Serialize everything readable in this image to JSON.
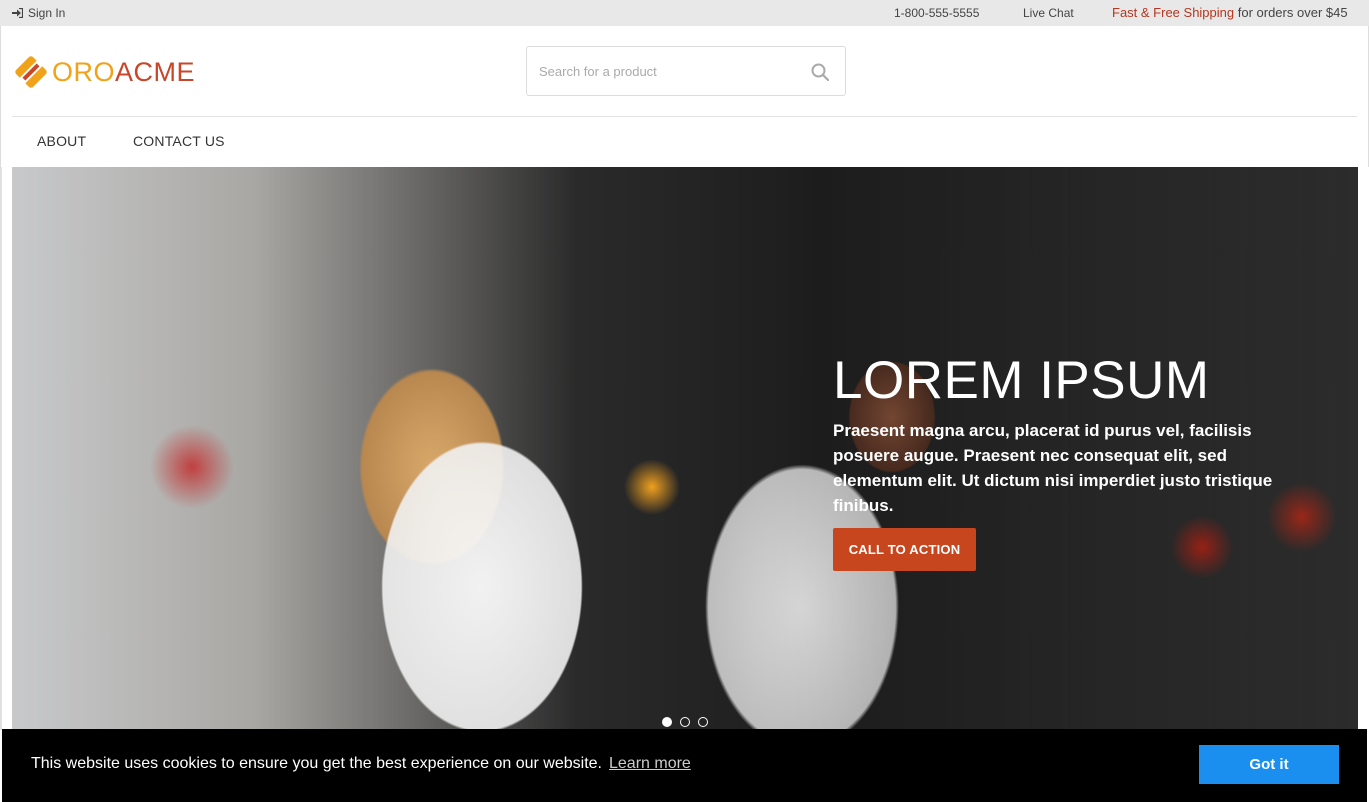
{
  "topbar": {
    "signin_label": "Sign In",
    "phone": "1-800-555-5555",
    "live_chat": "Live Chat",
    "shipping_accent": "Fast & Free Shipping",
    "shipping_rest": " for orders over $45"
  },
  "header": {
    "logo_part1": "ORO",
    "logo_part2": "ACME",
    "search_placeholder": "Search for a product"
  },
  "nav": {
    "items": [
      {
        "label": "ABOUT"
      },
      {
        "label": "CONTACT US"
      }
    ]
  },
  "hero": {
    "title": "LOREM IPSUM",
    "text": "Praesent magna arcu, placerat id purus vel, facilisis posuere augue. Praesent nec consequat elit, sed elementum elit. Ut dictum nisi imperdiet justo tristique finibus.",
    "cta_label": "CALL TO ACTION",
    "slides_total": 3,
    "active_slide": 1
  },
  "cookie": {
    "message": "This website uses cookies to ensure you get the best experience on our website.",
    "learn_more": "Learn more",
    "button": "Got it"
  },
  "colors": {
    "accent": "#c8461e",
    "logo_orange": "#f0a31a",
    "cookie_button": "#1a8ff0"
  }
}
